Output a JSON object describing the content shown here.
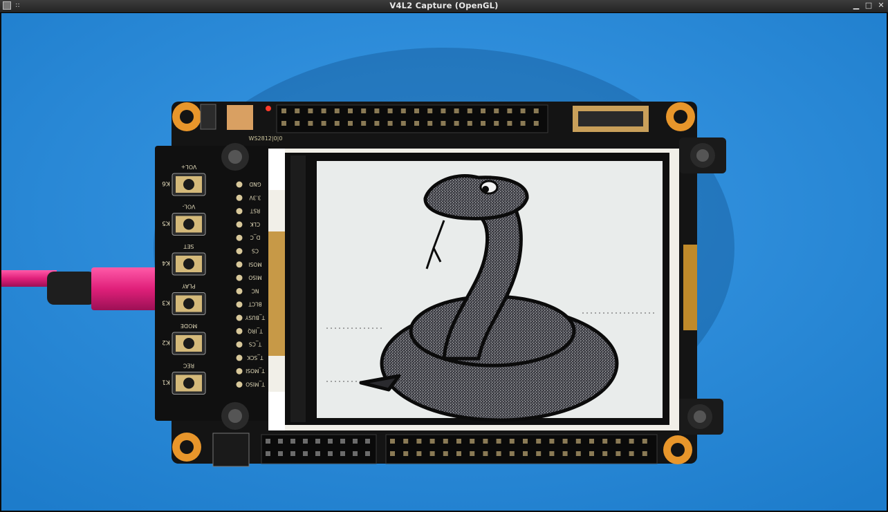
{
  "window": {
    "title": "V4L2 Capture (OpenGL)",
    "controls": {
      "minimize": "▁",
      "maximize": "□",
      "close": "✕"
    }
  },
  "board": {
    "resistor_label": "WS2812|0|0",
    "keys": [
      {
        "key": "K6",
        "function": "VOL+"
      },
      {
        "key": "K5",
        "function": "VOL-"
      },
      {
        "key": "K4",
        "function": "SET"
      },
      {
        "key": "K3",
        "function": "PLAY"
      },
      {
        "key": "K2",
        "function": "MODE"
      },
      {
        "key": "K1",
        "function": "REC"
      }
    ],
    "pins": [
      "GND",
      "3.3V",
      "RST",
      "CLK",
      "D_C",
      "CS",
      "MOSI",
      "MISO",
      "NC",
      "BLCT",
      "T_BUSY",
      "T_IRQ",
      "T_CS",
      "T_SCK",
      "T_MOSI",
      "T_MISO"
    ]
  },
  "colors": {
    "background": "#2487d6",
    "pcb": "#141414",
    "screen": "#e9eceb",
    "cable": "#e0207a"
  }
}
